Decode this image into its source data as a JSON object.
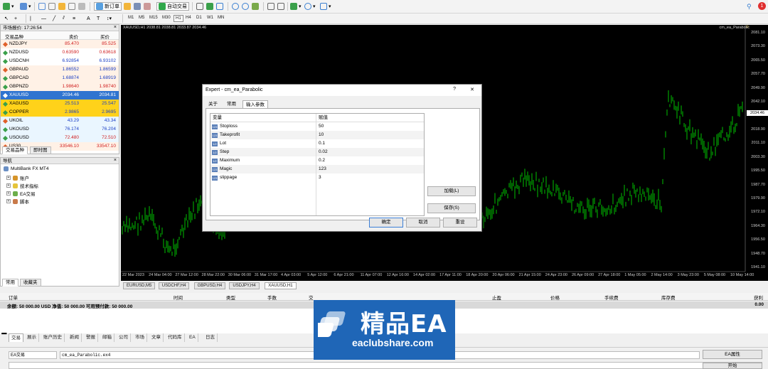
{
  "toolbar": {
    "new_order": "新订单",
    "auto_trading": "自动交易",
    "timeframes": [
      "M1",
      "M5",
      "M15",
      "M30",
      "H1",
      "H4",
      "D1",
      "W1",
      "MN"
    ],
    "active_timeframe": "H1"
  },
  "market_watch": {
    "title": "市场报价: 17:26:54",
    "col_symbol": "交易品种",
    "col_bid": "卖价",
    "col_ask": "买价",
    "rows": [
      {
        "symbol": "NZDJPY",
        "bid": "85.470",
        "ask": "85.525",
        "bg": "#fff1e6",
        "color": "#d02020"
      },
      {
        "symbol": "NZDUSD",
        "bid": "0.63590",
        "ask": "0.63618",
        "bg": "#ffffff",
        "color": "#d02020"
      },
      {
        "symbol": "USDCNH",
        "bid": "6.92854",
        "ask": "6.93102",
        "bg": "#ffffff",
        "color": "#1b3fc4"
      },
      {
        "symbol": "GBPAUD",
        "bid": "1.86552",
        "ask": "1.86599",
        "bg": "#fff1e6",
        "color": "#1b3fc4"
      },
      {
        "symbol": "GBPCAD",
        "bid": "1.68874",
        "ask": "1.68919",
        "bg": "#fff1e6",
        "color": "#1b3fc4"
      },
      {
        "symbol": "GBPNZD",
        "bid": "1.98640",
        "ask": "1.98740",
        "bg": "#fff1e6",
        "color": "#d02020"
      },
      {
        "symbol": "XAUUSD",
        "bid": "2034.46",
        "ask": "2034.81",
        "bg": "#2f74d0",
        "color": "#ffffff"
      },
      {
        "symbol": "XAGUSD",
        "bid": "25.513",
        "ask": "25.547",
        "bg": "#ffd21a",
        "color": "#1b3fc4"
      },
      {
        "symbol": "COPPER",
        "bid": "2.9865",
        "ask": "2.9695",
        "bg": "#ffd21a",
        "color": "#1b3fc4"
      },
      {
        "symbol": "UKOIL",
        "bid": "43.29",
        "ask": "43.34",
        "bg": "#eaf6ff",
        "color": "#1b3fc4"
      },
      {
        "symbol": "UKOUSD",
        "bid": "76.174",
        "ask": "76.204",
        "bg": "#eaf6ff",
        "color": "#1b3fc4"
      },
      {
        "symbol": "USOUSD",
        "bid": "72.480",
        "ask": "72.510",
        "bg": "#eaf6ff",
        "color": "#d02020"
      },
      {
        "symbol": "US30",
        "bid": "33546.10",
        "ask": "33547.10",
        "bg": "#fff1e6",
        "color": "#d02020"
      }
    ],
    "tabs": [
      "交易品种",
      "即时图"
    ]
  },
  "navigator": {
    "title": "导航",
    "items": [
      "MultiBank FX MT4",
      "账户",
      "技术指标",
      "EA交易",
      "脚本"
    ],
    "tabs": [
      "常用",
      "收藏夹"
    ]
  },
  "chart": {
    "title": "XAUUSD,H1  2038.81 2038.81 2033.87 2034.46",
    "ea_label": "cm_ea_Parabolic",
    "current_price": "2034.46",
    "y_ticks": [
      "2081.10",
      "2073.30",
      "2065.50",
      "2057.70",
      "2049.90",
      "2042.10",
      "2026.70",
      "2018.90",
      "2011.10",
      "2003.30",
      "1995.50",
      "1987.70",
      "1979.90",
      "1972.10",
      "1964.30",
      "1956.50",
      "1948.70",
      "1941.10"
    ],
    "x_ticks": [
      "22 Mar 2023",
      "24 Mar 04:00",
      "27 Mar 12:00",
      "28 Mar 22:00",
      "30 Mar 06:00",
      "31 Mar 17:00",
      "4 Apr 03:00",
      "5 Apr 12:00",
      "6 Apr 21:00",
      "11 Apr 07:00",
      "12 Apr 16:00",
      "14 Apr 02:00",
      "17 Apr 11:00",
      "18 Apr 20:00",
      "20 Apr 06:00",
      "21 Apr 15:00",
      "24 Apr 23:00",
      "26 Apr 09:00",
      "27 Apr 18:00",
      "1 May 05:00",
      "2 May 14:00",
      "3 May 23:00",
      "5 May 08:00",
      "10 May 14:00"
    ],
    "candle_color": "#00c000",
    "tabs": [
      "EURUSD,M5",
      "USDCHF,H4",
      "GBPUSD,H4",
      "USDJPY,H4",
      "XAUUSD,H1"
    ],
    "active_tab": "XAUUSD,H1"
  },
  "dialog": {
    "title": "Expert - cm_ea_Parabolic",
    "help": "?",
    "close": "✕",
    "tabs": [
      "关于",
      "常用",
      "输入参数"
    ],
    "active_tab": "输入参数",
    "col_var": "变量",
    "col_val": "赋值",
    "params": [
      {
        "name": "Stoploss",
        "value": "50",
        "icon": "123"
      },
      {
        "name": "Takeprofit",
        "value": "10",
        "icon": "123"
      },
      {
        "name": "Lot",
        "value": "0.1",
        "icon": "1/2"
      },
      {
        "name": "Step",
        "value": "0.02",
        "icon": "1/2"
      },
      {
        "name": "Maximum",
        "value": "0.2",
        "icon": "1/2"
      },
      {
        "name": "Magic",
        "value": "123",
        "icon": "123"
      },
      {
        "name": "slippage",
        "value": "3",
        "icon": "123"
      }
    ],
    "load_btn": "加载(L)",
    "save_btn": "保存(S)",
    "ok_btn": "确定",
    "cancel_btn": "取消",
    "reset_btn": "重设"
  },
  "terminal": {
    "headers": [
      "订单",
      "时间",
      "类型",
      "手数",
      "交",
      "止盈",
      "价格",
      "手续费",
      "库存费",
      "获利"
    ],
    "balance_text": "余额: 50 000.00 USD  净值: 50 000.00  可用预付款: 50 000.00",
    "balance_profit": "0.00",
    "tabs": [
      "交易",
      "展示",
      "账户历史",
      "新闻",
      "警报",
      "邮箱",
      "公司",
      "市场",
      "文章",
      "代码库",
      "EA",
      "日志"
    ],
    "active_tab": "交易"
  },
  "watermark": {
    "title": "精品EA",
    "url": "eaclubshare.com"
  },
  "ea_bar": {
    "label": "EA交易",
    "value": "cm_ea_Parabolic.ex4",
    "props_btn": "EA属性",
    "start_btn": "开始"
  }
}
